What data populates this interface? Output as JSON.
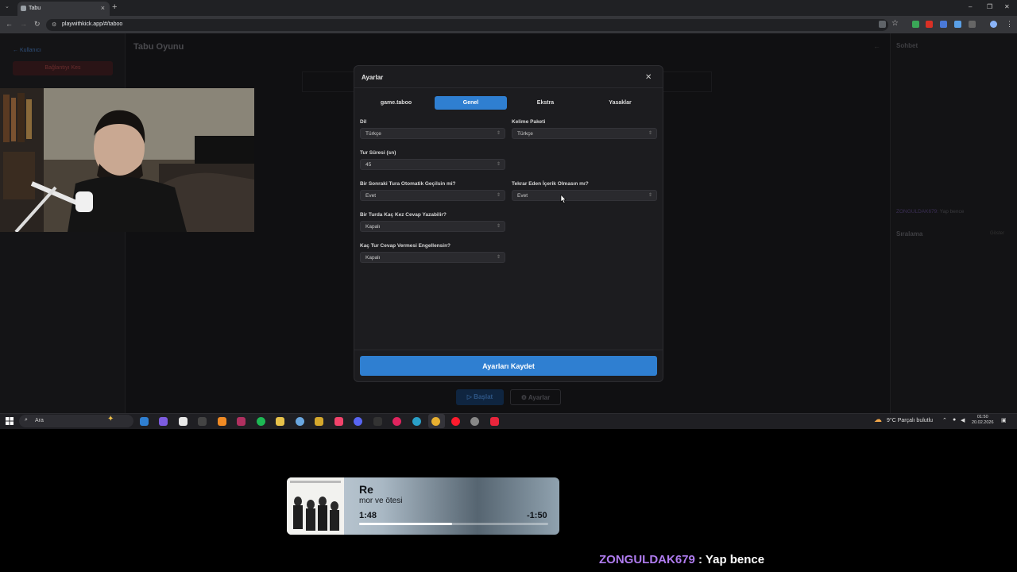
{
  "browser": {
    "tab_title": "Tabu",
    "url": "playwithkick.app/#/taboo"
  },
  "page": {
    "back_link": "← Kullanıcı",
    "disconnect": "Bağlantıyı Kes",
    "title": "Tabu Oyunu",
    "chat_title": "Sohbet",
    "chat_message": {
      "user": "ZONGULDAK679:",
      "text": " Yap bence"
    },
    "ranking_title": "Sıralama",
    "ranking_action": "Göster",
    "start_button": "▷ Başlat",
    "settings_button": "⚙ Ayarlar"
  },
  "modal": {
    "title": "Ayarlar",
    "tabs": [
      {
        "label": "game.taboo",
        "active": false
      },
      {
        "label": "Genel",
        "active": true
      },
      {
        "label": "Ekstra",
        "active": false
      },
      {
        "label": "Yasaklar",
        "active": false
      }
    ],
    "fields": {
      "language": {
        "label": "Dil",
        "value": "Türkçe"
      },
      "word_pack": {
        "label": "Kelime Paketi",
        "value": "Türkçe"
      },
      "round_time": {
        "label": "Tur Süresi (sn)",
        "value": "45"
      },
      "auto_next": {
        "label": "Bir Sonraki Tura Otomatik Geçilsin mi?",
        "value": "Evet"
      },
      "no_repeat": {
        "label": "Tekrar Eden İçerik Olmasın mı?",
        "value": "Evet"
      },
      "answers_per_round": {
        "label": "Bir Turda Kaç Kez Cevap Yazabilir?",
        "value": "Kapalı"
      },
      "block_rounds": {
        "label": "Kaç Tur Cevap Vermesi Engellensin?",
        "value": "Kapalı"
      }
    },
    "save_button": "Ayarları Kaydet"
  },
  "taskbar": {
    "search_placeholder": "Ara",
    "weather": "9°C  Parçalı bulutlu",
    "time": "01:50",
    "date": "20.02.2026"
  },
  "music": {
    "title": "Re",
    "artist": "mor ve ötesi",
    "elapsed": "1:48",
    "remaining": "-1:50",
    "progress": 0.49
  },
  "overlay": {
    "user": "ZONGULDAK679",
    "message": " : Yap bence"
  },
  "colors": {
    "accent": "#2f7fd1",
    "overlay_user": "#b07cf0"
  }
}
